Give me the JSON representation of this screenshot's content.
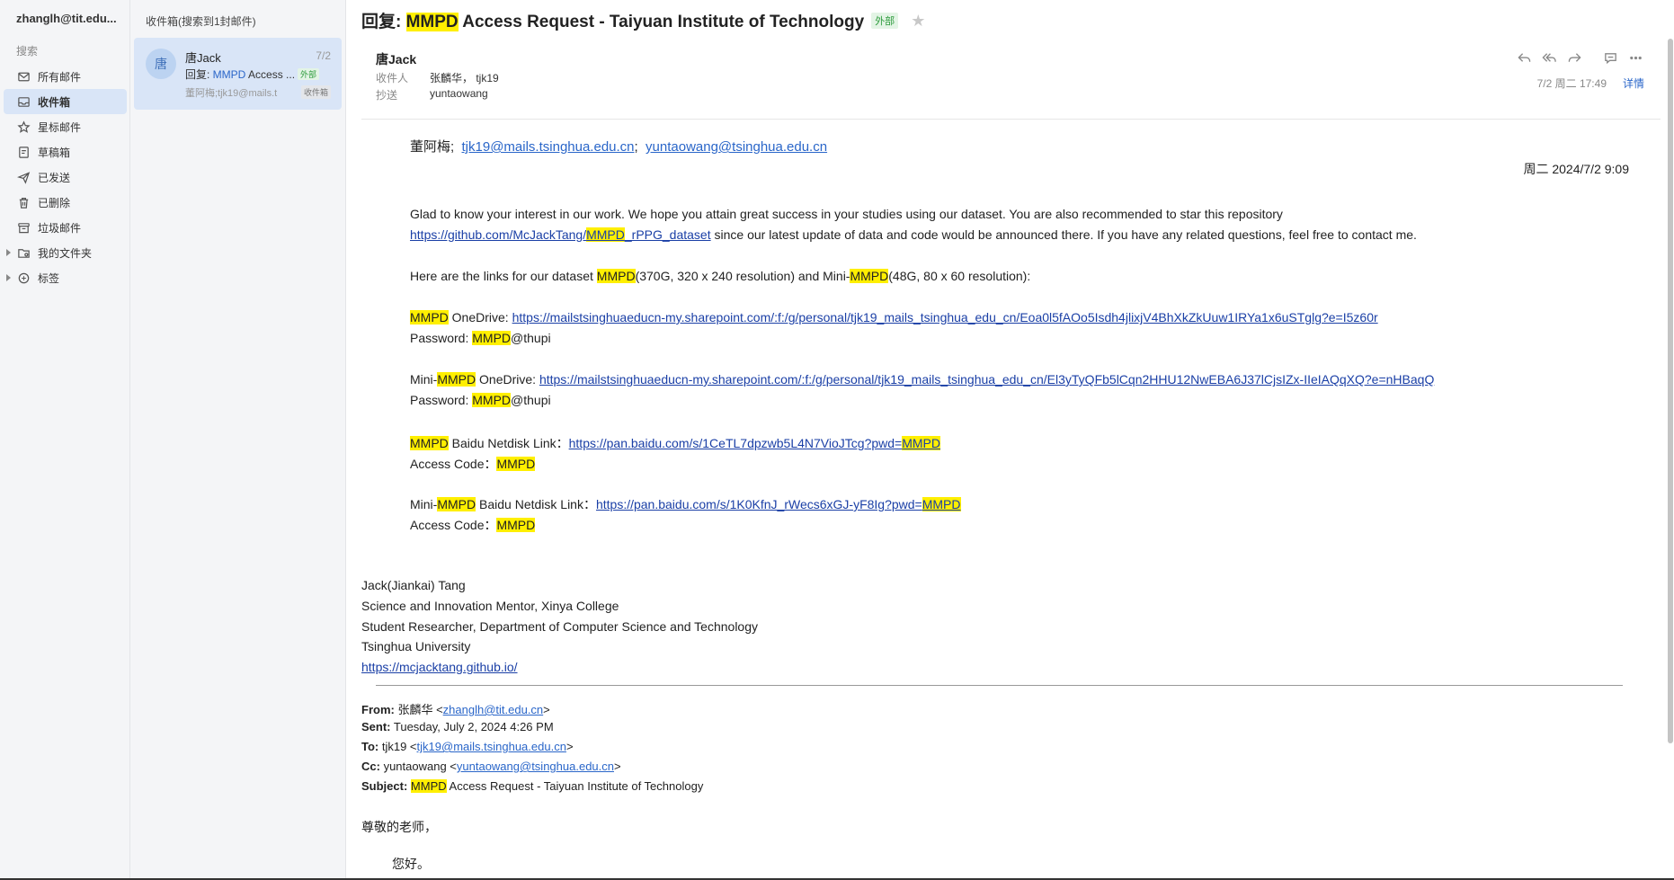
{
  "sidebar": {
    "account": "zhanglh@tit.edu...",
    "search_label": "搜索",
    "items": [
      {
        "label": "所有邮件",
        "icon": "mail-icon"
      },
      {
        "label": "收件箱",
        "icon": "inbox-icon",
        "active": true
      },
      {
        "label": "星标邮件",
        "icon": "star-icon"
      },
      {
        "label": "草稿箱",
        "icon": "draft-icon"
      },
      {
        "label": "已发送",
        "icon": "send-icon"
      },
      {
        "label": "已删除",
        "icon": "trash-icon"
      },
      {
        "label": "垃圾邮件",
        "icon": "junk-icon"
      },
      {
        "label": "我的文件夹",
        "icon": "folder-icon",
        "expandable": true
      },
      {
        "label": "标签",
        "icon": "tag-icon",
        "expandable": true
      }
    ]
  },
  "list": {
    "header": "收件箱(搜索到1封邮件)",
    "card": {
      "avatar": "唐",
      "sender": "唐Jack",
      "date": "7/2",
      "subject_prefix": "回复: ",
      "subject_highlight": "MMPD",
      "subject_rest": " Access ...",
      "external_tag": "外部",
      "preview": "董阿梅;tjk19@mails.t",
      "folder_tag": "收件箱"
    }
  },
  "reader": {
    "subject_prefix": "回复: ",
    "subject_highlight": "MMPD",
    "subject_rest": " Access Request - Taiyuan Institute of Technology",
    "external_tag": "外部",
    "from_name": "唐Jack",
    "to_label": "收件人",
    "to_value": "张麟华， tjk19",
    "cc_label": "抄送",
    "cc_value": "yuntaowang",
    "date": "7/2 周二 17:49",
    "details": "详情"
  },
  "body": {
    "salutation_name": "董阿梅;",
    "salutation_email1": "tjk19@mails.tsinghua.edu.cn",
    "salutation_sep": ";",
    "salutation_email2": "yuntaowang@tsinghua.edu.cn",
    "sent_date": "周二 2024/7/2 9:09",
    "p1_line1": "Glad to know your interest in our work. We hope you attain great success in your studies using our dataset. You are also recommended to star this repository",
    "p1_link_a": "https://github.com/McJackTang/",
    "p1_link_mark": "MMPD",
    "p1_link_b": "_rPPG_dataset",
    "p1_rest": " since our latest update of data and code would be announced there. If you have any related questions, feel free to contact me.",
    "p2_a": "Here are the links for our dataset ",
    "p2_mark1": "MMPD",
    "p2_b": "(370G, 320 x 240 resolution) and Mini-",
    "p2_mark2": "MMPD",
    "p2_c": "(48G, 80 x 60 resolution):",
    "od1_mark": "MMPD",
    "od1_label": " OneDrive: ",
    "od1_link": "https://mailstsinghuaeducn-my.sharepoint.com/:f:/g/personal/tjk19_mails_tsinghua_edu_cn/Eoa0l5fAOo5Isdh4jlixjV4BhXkZkUuw1IRYa1x6uSTglg?e=I5z60r",
    "pw_label": "Password: ",
    "pw_mark": "MMPD",
    "pw_rest": "@thupi",
    "od2_prefix": "Mini-",
    "od2_mark": "MMPD",
    "od2_label": " OneDrive: ",
    "od2_link": "https://mailstsinghuaeducn-my.sharepoint.com/:f:/g/personal/tjk19_mails_tsinghua_edu_cn/El3yTyQFb5lCqn2HHU12NwEBA6J37lCjsIZx-IIeIAQqXQ?e=nHBaqQ",
    "bd1_mark": "MMPD",
    "bd1_label": " Baidu Netdisk Link：",
    "bd1_link": "https://pan.baidu.com/s/1CeTL7dpzwb5L4N7VioJTcg?pwd=",
    "bd1_link_mark": "MMPD",
    "ac_label": "Access Code：",
    "ac_mark": "MMPD",
    "bd2_prefix": "Mini-",
    "bd2_mark": "MMPD",
    "bd2_label": " Baidu Netdisk Link：",
    "bd2_link": "https://pan.baidu.com/s/1K0KfnJ_rWecs6xGJ-yF8Ig?pwd=",
    "bd2_link_mark": "MMPD",
    "sig_name": "Jack(Jiankai) Tang",
    "sig_line2": "Science and Innovation Mentor, Xinya College",
    "sig_line3": "Student Researcher, Department of Computer Science and Technology",
    "sig_line4": "Tsinghua University",
    "sig_link": "https://mcjacktang.github.io/",
    "q_from_label": "From:",
    "q_from_name": " 张麟华 <",
    "q_from_email": "zhanglh@tit.edu.cn",
    "q_close": ">",
    "q_sent_label": "Sent:",
    "q_sent": " Tuesday, July 2, 2024 4:26 PM",
    "q_to_label": "To:",
    "q_to_name": " tjk19 <",
    "q_to_email": "tjk19@mails.tsinghua.edu.cn",
    "q_cc_label": "Cc:",
    "q_cc_name": " yuntaowang <",
    "q_cc_email": "yuntaowang@tsinghua.edu.cn",
    "q_subject_label": "Subject:",
    "q_subject_mark": "MMPD",
    "q_subject_rest": " Access Request - Taiyuan Institute of Technology",
    "q_greeting": "尊敬的老师，",
    "q_hello": "您好。"
  },
  "colors": {
    "highlight": "#ffef00",
    "link": "#1a3fa6",
    "accent": "#2a66c9",
    "active_bg": "#d9e5f7"
  }
}
